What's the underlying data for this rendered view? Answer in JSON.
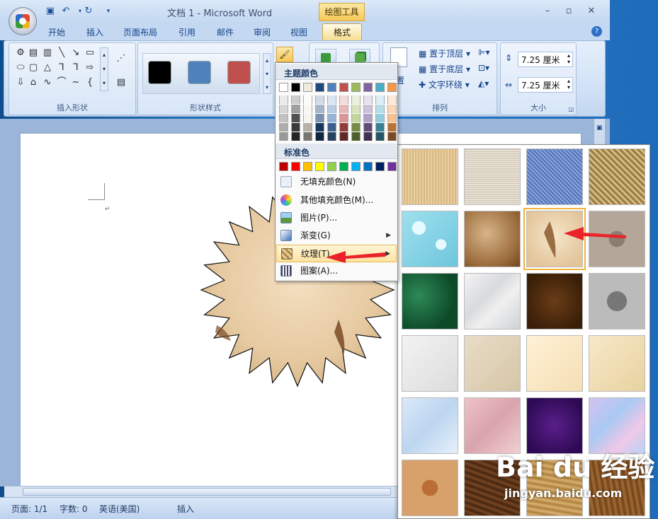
{
  "window": {
    "title": "文档 1 - Microsoft Word",
    "contextual_tab_group": "绘图工具"
  },
  "tabs": [
    "开始",
    "插入",
    "页面布局",
    "引用",
    "邮件",
    "审阅",
    "视图",
    "格式"
  ],
  "active_tab": "格式",
  "ribbon": {
    "groups": {
      "insert_shapes": "插入形状",
      "shape_styles": "形状样式",
      "arrange": "排列",
      "size": "大小"
    },
    "arrange": {
      "bring_to_front": "置于顶层",
      "send_to_back": "置于底层",
      "text_wrap": "文字环绕",
      "position_partial": "置"
    },
    "size": {
      "height": "7.25 厘米",
      "width": "7.25 厘米"
    },
    "style_swatches": [
      "#000000",
      "#4f81bd",
      "#c0504d"
    ]
  },
  "fill_menu": {
    "theme_colors_header": "主题颜色",
    "standard_colors_header": "标准色",
    "items": {
      "no_fill": "无填充颜色(N)",
      "more_colors": "其他填充颜色(M)...",
      "picture": "图片(P)...",
      "gradient": "渐变(G)",
      "texture": "纹理(T)",
      "pattern": "图案(A)..."
    },
    "theme_colors": [
      "#ffffff",
      "#000000",
      "#eeece1",
      "#1f497d",
      "#4f81bd",
      "#c0504d",
      "#9bbb59",
      "#8064a2",
      "#4bacc6",
      "#f79646"
    ],
    "standard_colors": [
      "#c00000",
      "#ff0000",
      "#ffc000",
      "#ffff00",
      "#92d050",
      "#00b050",
      "#00b0f0",
      "#0070c0",
      "#002060",
      "#7030a0"
    ]
  },
  "status": {
    "page": "页面: 1/1",
    "words": "字数: 0",
    "language": "英语(美国)",
    "mode": "插入"
  },
  "watermark": {
    "brand": "Bai du 经验",
    "url": "jingyan.baidu.com"
  }
}
